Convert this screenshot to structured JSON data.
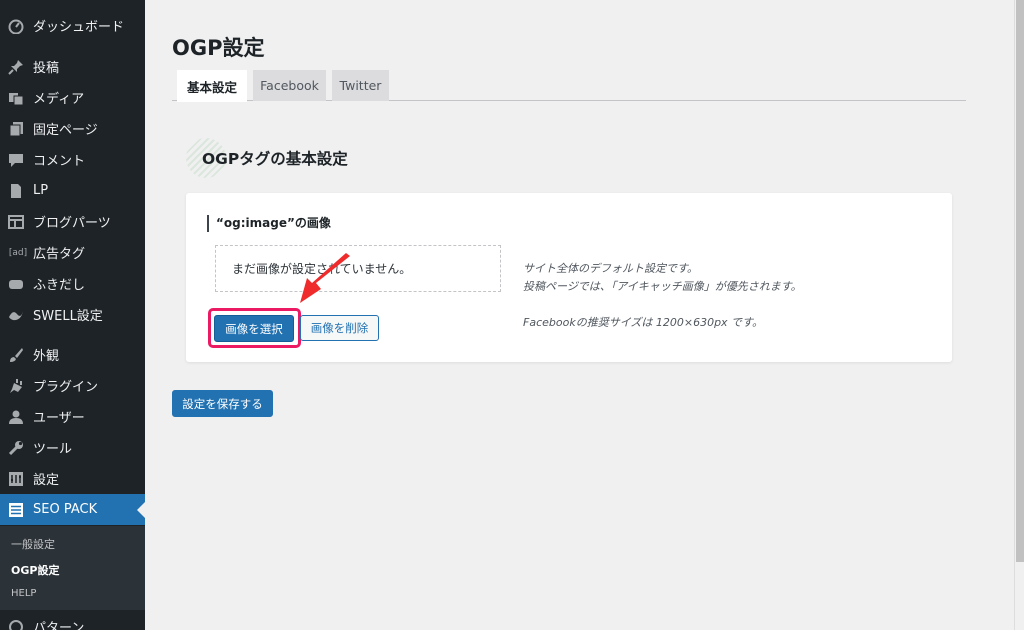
{
  "sidebar": {
    "items": [
      {
        "label": "ダッシュボード",
        "icon": "dashboard-icon"
      },
      {
        "label": "投稿",
        "icon": "pin-icon"
      },
      {
        "label": "メディア",
        "icon": "media-icon"
      },
      {
        "label": "固定ページ",
        "icon": "page-icon"
      },
      {
        "label": "コメント",
        "icon": "comment-icon"
      },
      {
        "label": "LP",
        "icon": "document-icon"
      },
      {
        "label": "ブログパーツ",
        "icon": "layout-icon"
      },
      {
        "label": "広告タグ",
        "icon": "ad-icon",
        "icon_text": "[ad]"
      },
      {
        "label": "ふきだし",
        "icon": "speech-bubble-icon"
      },
      {
        "label": "SWELL設定",
        "icon": "swell-icon"
      },
      {
        "label": "外観",
        "icon": "brush-icon"
      },
      {
        "label": "プラグイン",
        "icon": "plugin-icon"
      },
      {
        "label": "ユーザー",
        "icon": "user-icon"
      },
      {
        "label": "ツール",
        "icon": "wrench-icon"
      },
      {
        "label": "設定",
        "icon": "settings-icon"
      },
      {
        "label": "SEO PACK",
        "icon": "list-icon"
      },
      {
        "label": "パターン",
        "icon": "pattern-icon"
      }
    ],
    "submenu": [
      "一般設定",
      "OGP設定",
      "HELP"
    ]
  },
  "main": {
    "title": "OGP設定",
    "tabs": [
      "基本設定",
      "Facebook",
      "Twitter"
    ],
    "section_heading": "OGPタグの基本設定",
    "field_label": "“og:image”の画像",
    "preview_text": "まだ画像が設定されていません。",
    "select_button": "画像を選択",
    "delete_button": "画像を削除",
    "descriptions": [
      "サイト全体のデフォルト設定です。",
      "投稿ページでは、「アイキャッチ画像」が優先されます。",
      "Facebookの推奨サイズは 1200×630px です。"
    ],
    "save_button": "設定を保存する"
  },
  "colors": {
    "sidebar_bg": "#1d2327",
    "accent": "#2271b1",
    "highlight": "#ec1a62"
  }
}
